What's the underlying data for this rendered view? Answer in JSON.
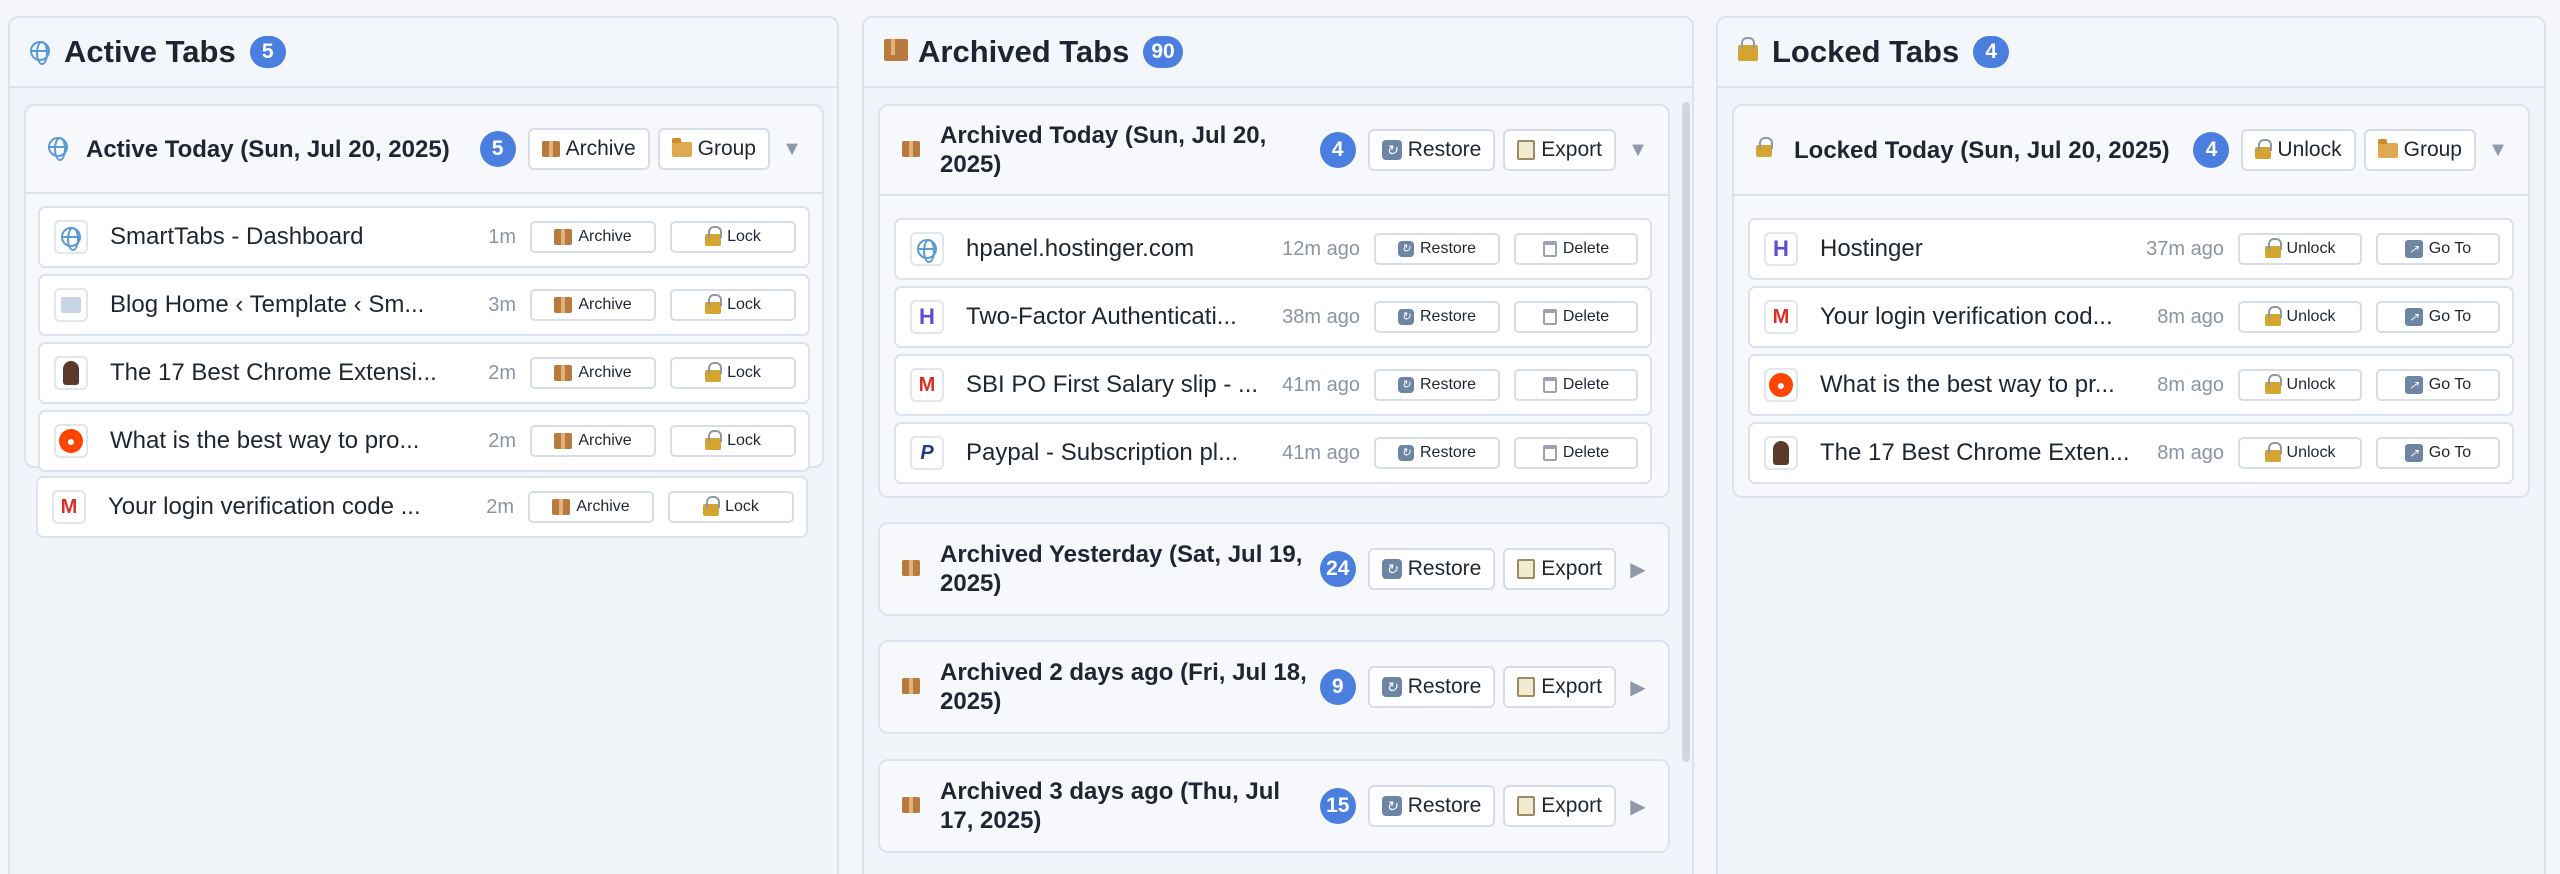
{
  "columns": {
    "active": {
      "title": "Active Tabs",
      "count": "5",
      "groups": [
        {
          "title": "Active Today (Sun, Jul 20, 2025)",
          "count": "5",
          "buttons": [
            "Archive",
            "Group"
          ],
          "expanded": true,
          "tabs": [
            {
              "title": "SmartTabs - Dashboard",
              "time": "1m",
              "favicon": "globe-icon"
            },
            {
              "title": "Blog Home ‹ Template ‹ Sm...",
              "time": "3m",
              "favicon": "blog-icon"
            },
            {
              "title": "The 17 Best Chrome Extensi...",
              "time": "2m",
              "favicon": "avatar-icon"
            },
            {
              "title": "What is the best way to pro...",
              "time": "2m",
              "favicon": "reddit-icon"
            },
            {
              "title": "Your login verification code ...",
              "time": "2m",
              "favicon": "gmail-icon"
            }
          ],
          "row_actions": [
            "Archive",
            "Lock"
          ]
        }
      ]
    },
    "archived": {
      "title": "Archived Tabs",
      "count": "90",
      "groups": [
        {
          "title": "Archived Today (Sun, Jul 20, 2025)",
          "count": "4",
          "buttons": [
            "Restore",
            "Export"
          ],
          "expanded": true,
          "tabs": [
            {
              "title": "hpanel.hostinger.com",
              "time": "12m ago",
              "favicon": "globe-icon"
            },
            {
              "title": "Two-Factor Authenticati...",
              "time": "38m ago",
              "favicon": "hostinger-icon"
            },
            {
              "title": "SBI PO First Salary slip - ...",
              "time": "41m ago",
              "favicon": "gmail-icon"
            },
            {
              "title": "Paypal - Subscription pl...",
              "time": "41m ago",
              "favicon": "paypal-icon"
            }
          ],
          "row_actions": [
            "Restore",
            "Delete"
          ]
        },
        {
          "title": "Archived Yesterday (Sat, Jul 19, 2025)",
          "count": "24",
          "buttons": [
            "Restore",
            "Export"
          ],
          "expanded": false
        },
        {
          "title": "Archived 2 days ago (Fri, Jul 18, 2025)",
          "count": "9",
          "buttons": [
            "Restore",
            "Export"
          ],
          "expanded": false
        },
        {
          "title": "Archived 3 days ago (Thu, Jul 17, 2025)",
          "count": "15",
          "buttons": [
            "Restore",
            "Export"
          ],
          "expanded": false
        }
      ]
    },
    "locked": {
      "title": "Locked Tabs",
      "count": "4",
      "groups": [
        {
          "title": "Locked Today (Sun, Jul 20, 2025)",
          "count": "4",
          "buttons": [
            "Unlock",
            "Group"
          ],
          "expanded": true,
          "tabs": [
            {
              "title": "Hostinger",
              "time": "37m ago",
              "favicon": "hostinger-icon"
            },
            {
              "title": "Your login verification cod...",
              "time": "8m ago",
              "favicon": "gmail-icon"
            },
            {
              "title": "What is the best way to pr...",
              "time": "8m ago",
              "favicon": "reddit-icon"
            },
            {
              "title": "The 17 Best Chrome Exten...",
              "time": "8m ago",
              "favicon": "avatar-icon"
            }
          ],
          "row_actions": [
            "Unlock",
            "Go To"
          ]
        }
      ]
    }
  },
  "colors": {
    "badge": "#4a7fe0",
    "panel_bg": "#f1f4f9",
    "border": "#dde3ec"
  }
}
